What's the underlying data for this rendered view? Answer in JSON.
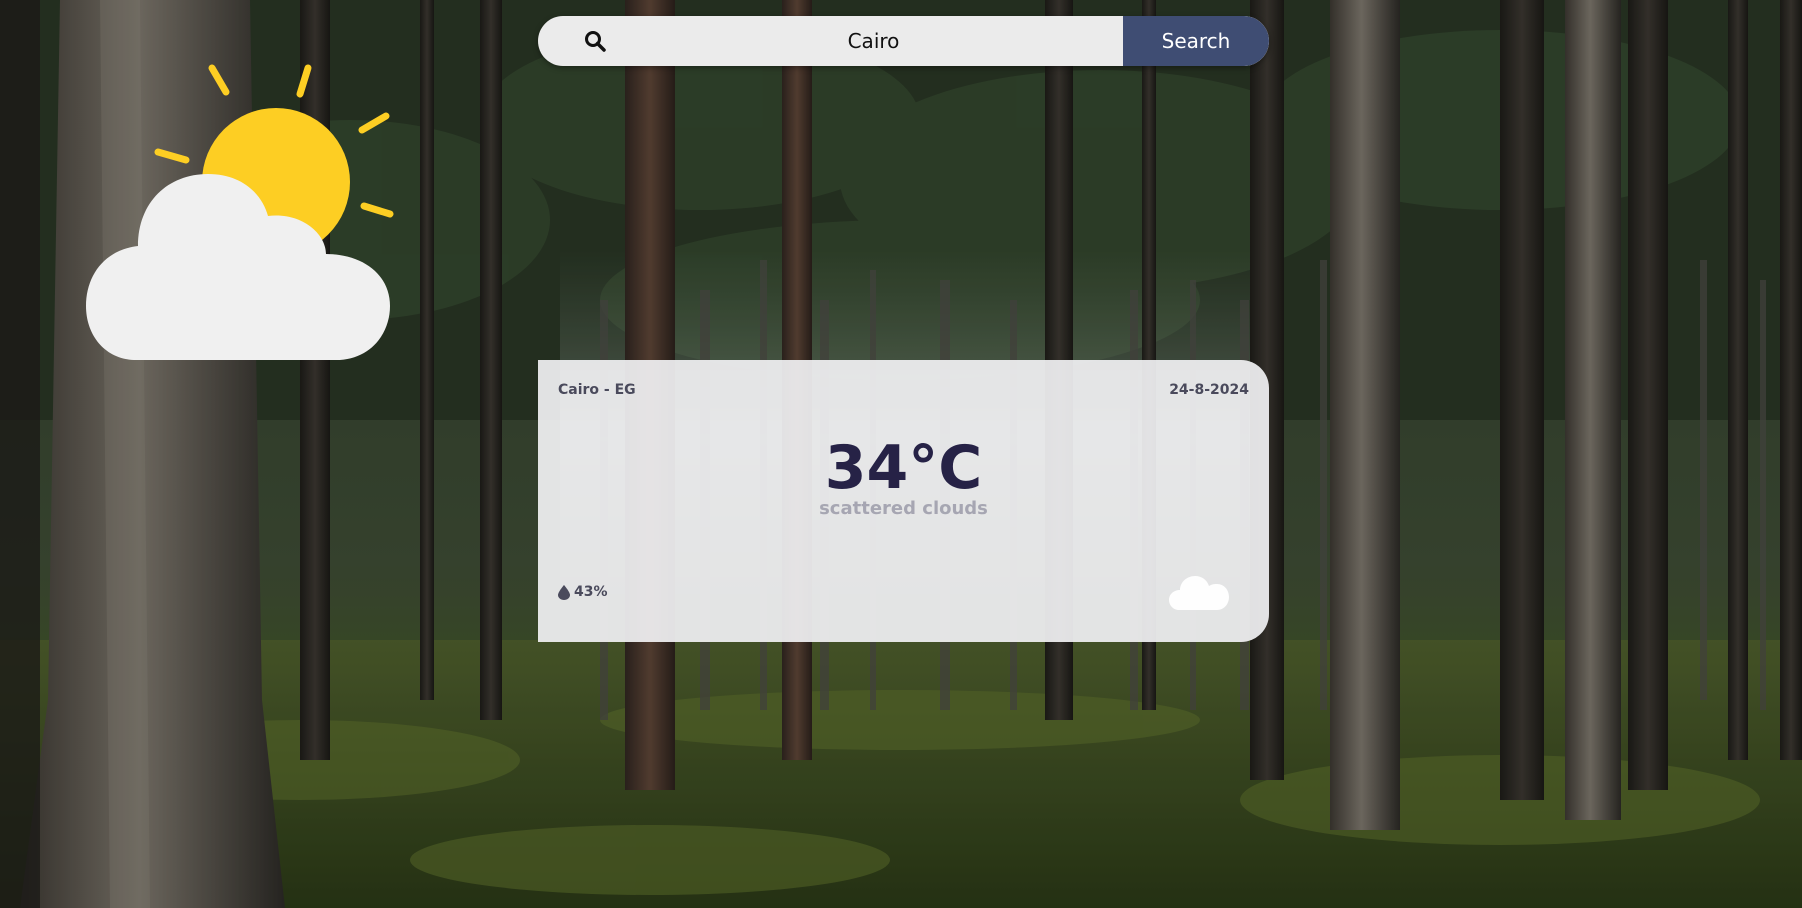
{
  "search": {
    "value": "Cairo",
    "button_label": "Search"
  },
  "weather": {
    "location": "Cairo - EG",
    "date": "24-8-2024",
    "temperature": "34°C",
    "description": "scattered clouds",
    "humidity": "43%",
    "condition_icon": "cloud-icon",
    "hero_icon": "sun-behind-cloud-icon"
  },
  "colors": {
    "search_button": "#3f4d73",
    "temperature_text": "#262246",
    "sun": "#fdce23",
    "cloud": "#f0f0f0"
  }
}
